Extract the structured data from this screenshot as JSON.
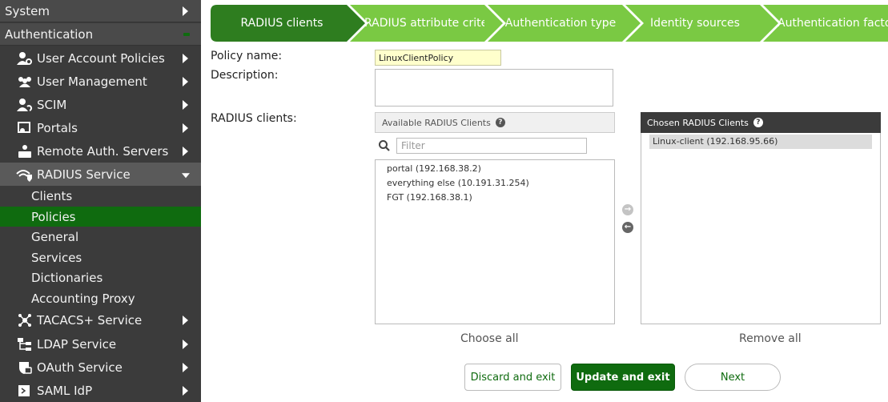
{
  "sidebar": {
    "top": [
      {
        "label": "System"
      },
      {
        "label": "Authentication"
      }
    ],
    "items": [
      {
        "label": "User Account Policies",
        "icon": "user-gear-icon"
      },
      {
        "label": "User Management",
        "icon": "users-icon"
      },
      {
        "label": "SCIM",
        "icon": "user-sync-icon"
      },
      {
        "label": "Portals",
        "icon": "portal-icon"
      },
      {
        "label": "Remote Auth. Servers",
        "icon": "server-user-icon"
      },
      {
        "label": "RADIUS Service",
        "icon": "wifi-shield-icon"
      }
    ],
    "sub_items": [
      {
        "label": "Clients"
      },
      {
        "label": "Policies"
      },
      {
        "label": "General"
      },
      {
        "label": "Services"
      },
      {
        "label": "Dictionaries"
      },
      {
        "label": "Accounting Proxy"
      }
    ],
    "items_after": [
      {
        "label": "TACACS+ Service",
        "icon": "network-icon"
      },
      {
        "label": "LDAP Service",
        "icon": "tree-icon"
      },
      {
        "label": "OAuth Service",
        "icon": "shield-lock-icon"
      },
      {
        "label": "SAML IdP",
        "icon": "id-card-icon"
      }
    ]
  },
  "steps": [
    {
      "label": "RADIUS clients",
      "active": true
    },
    {
      "label": "RADIUS attribute criteri",
      "active": false
    },
    {
      "label": "Authentication type",
      "active": false
    },
    {
      "label": "Identity sources",
      "active": false
    },
    {
      "label": "Authentication factors",
      "active": false
    }
  ],
  "form": {
    "policy_name_label": "Policy name:",
    "policy_name_value": "LinuxClientPolicy",
    "description_label": "Description:",
    "description_value": "",
    "radius_clients_label": "RADIUS clients:"
  },
  "available": {
    "title": "Available RADIUS Clients",
    "filter_placeholder": "Filter",
    "options": [
      "portal (192.168.38.2)",
      "everything else (10.191.31.254)",
      "FGT (192.168.38.1)"
    ],
    "choose_all": "Choose all"
  },
  "chosen": {
    "title": "Chosen RADIUS Clients",
    "options": [
      "Linux-client (192.168.95.66)"
    ],
    "remove_all": "Remove all"
  },
  "buttons": {
    "discard": "Discard and exit",
    "update": "Update and exit",
    "next": "Next"
  },
  "colors": {
    "sidebar_bg": "#3b3b3b",
    "active_green": "#0f6b0f",
    "step_active": "#2e7d1f",
    "step_inactive": "#7ac943"
  }
}
